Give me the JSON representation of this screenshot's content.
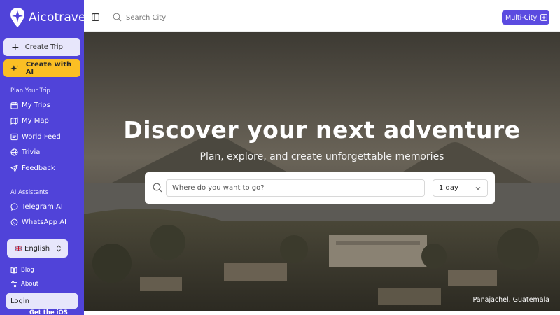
{
  "brand": {
    "name": "Aicotrave"
  },
  "sidebar": {
    "create_trip_label": "Create Trip",
    "create_ai_label": "Create with AI",
    "plan_section_label": "Plan Your Trip",
    "plan_items": [
      {
        "label": "My Trips",
        "icon": "calendar-icon"
      },
      {
        "label": "My Map",
        "icon": "map-icon"
      },
      {
        "label": "World Feed",
        "icon": "feed-icon"
      },
      {
        "label": "Trivia",
        "icon": "globe-icon"
      },
      {
        "label": "Feedback",
        "icon": "send-icon"
      }
    ],
    "ai_section_label": "AI Assistants",
    "ai_items": [
      {
        "label": "Telegram AI",
        "icon": "chat-bubble-icon"
      },
      {
        "label": "WhatsApp AI",
        "icon": "whatsapp-icon"
      }
    ],
    "language": {
      "selected": "English",
      "flag": "uk-flag-icon"
    },
    "footer_items": [
      {
        "label": "Blog",
        "icon": "book-icon"
      },
      {
        "label": "About",
        "icon": "sliders-icon"
      }
    ],
    "login_label": "Login",
    "ios_label": "Get the iOS"
  },
  "topbar": {
    "search_placeholder": "Search City",
    "multicity_label": "Multi-City"
  },
  "hero": {
    "title": "Discover your next adventure",
    "subtitle": "Plan, explore, and create unforgettable memories",
    "destination_placeholder": "Where do you want to go?",
    "days_selected": "1 day",
    "photo_caption": "Panajachel, Guatemala"
  },
  "colors": {
    "sidebar_bg": "#5043d9",
    "accent": "#5b4be0",
    "ai_button": "#fbbf24",
    "light_button": "#e7e6fb"
  }
}
